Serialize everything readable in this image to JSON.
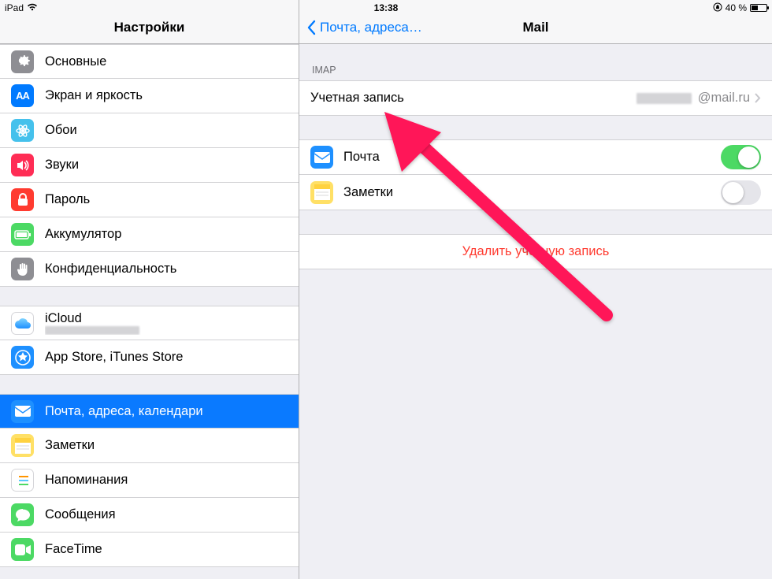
{
  "statusbar": {
    "device": "iPad",
    "time": "13:38",
    "battery_pct": "40 %"
  },
  "sidebar": {
    "title": "Настройки",
    "groups": [
      {
        "rows": [
          {
            "id": "general",
            "label": "Основные",
            "bg": "#8e8e93",
            "icon": "gear"
          },
          {
            "id": "display",
            "label": "Экран и яркость",
            "bg": "#007aff",
            "icon": "AA"
          },
          {
            "id": "wallpaper",
            "label": "Обои",
            "bg": "#45c1ec",
            "icon": "flower"
          },
          {
            "id": "sounds",
            "label": "Звуки",
            "bg": "#ff2d55",
            "icon": "speaker"
          },
          {
            "id": "passcode",
            "label": "Пароль",
            "bg": "#ff3b30",
            "icon": "lock"
          },
          {
            "id": "battery",
            "label": "Аккумулятор",
            "bg": "#4cd964",
            "icon": "battery"
          },
          {
            "id": "privacy",
            "label": "Конфиденциальность",
            "bg": "#8e8e93",
            "icon": "hand"
          }
        ]
      },
      {
        "rows": [
          {
            "id": "icloud",
            "label": "iCloud",
            "sub_redacted": true,
            "bg": "#ffffff",
            "icon": "cloud"
          },
          {
            "id": "appstore",
            "label": "App Store, iTunes Store",
            "bg": "#1e90ff",
            "icon": "appstore"
          }
        ]
      },
      {
        "rows": [
          {
            "id": "mail",
            "label": "Почта, адреса, календари",
            "selected": true,
            "bg": "#1e90ff",
            "icon": "mail"
          },
          {
            "id": "notes",
            "label": "Заметки",
            "bg": "#ffe066",
            "icon": "notes"
          },
          {
            "id": "reminders",
            "label": "Напоминания",
            "bg": "#ffffff",
            "icon": "reminders"
          },
          {
            "id": "messages",
            "label": "Сообщения",
            "bg": "#4cd964",
            "icon": "message"
          },
          {
            "id": "facetime",
            "label": "FaceTime",
            "bg": "#4cd964",
            "icon": "video"
          }
        ]
      }
    ]
  },
  "detail": {
    "back_label": "Почта, адреса…",
    "title": "Mail",
    "imap_header": "IMAP",
    "account": {
      "label": "Учетная запись",
      "value": "@mail.ru"
    },
    "services": [
      {
        "id": "mail_svc",
        "label": "Почта",
        "on": true,
        "bg": "#1e90ff",
        "icon": "mail"
      },
      {
        "id": "notes_svc",
        "label": "Заметки",
        "on": false,
        "bg": "#ffe066",
        "icon": "notes"
      }
    ],
    "delete_label": "Удалить учетную запись"
  }
}
